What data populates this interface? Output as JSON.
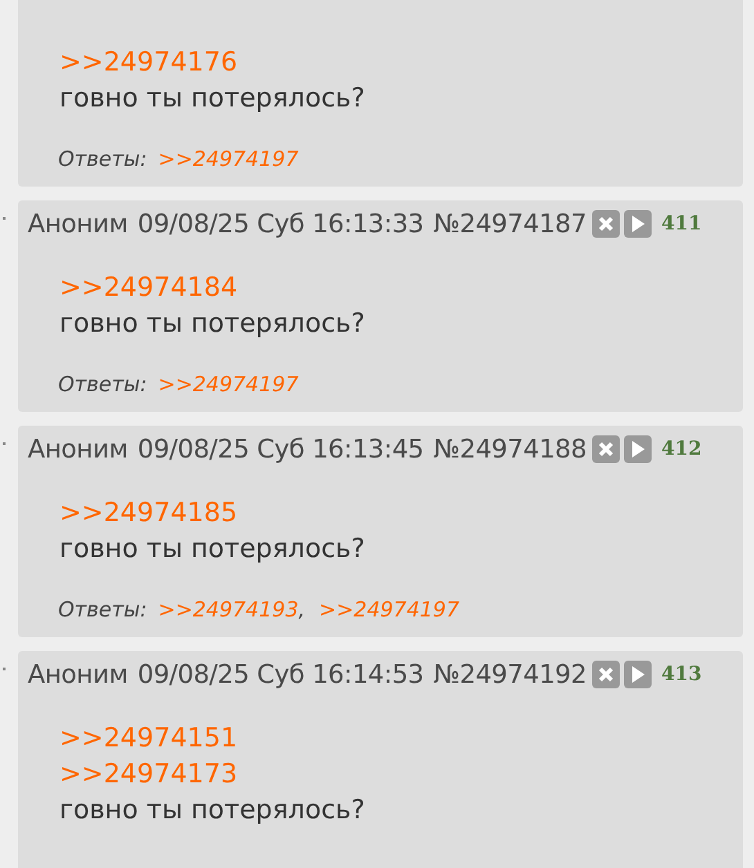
{
  "posts": [
    {
      "quotes": [
        ">>24974176"
      ],
      "text": "говно ты потерялось?",
      "replies_label": "Ответы:",
      "replies": [
        ">>24974197"
      ]
    },
    {
      "header": {
        "name": "Аноним",
        "date": "09/08/25 Суб 16:13:33",
        "number": "№24974187",
        "index": "411"
      },
      "quotes": [
        ">>24974184"
      ],
      "text": "говно ты потерялось?",
      "replies_label": "Ответы:",
      "replies": [
        ">>24974197"
      ]
    },
    {
      "header": {
        "name": "Аноним",
        "date": "09/08/25 Суб 16:13:45",
        "number": "№24974188",
        "index": "412"
      },
      "quotes": [
        ">>24974185"
      ],
      "text": "говно ты потерялось?",
      "replies_label": "Ответы:",
      "replies": [
        ">>24974193",
        ">>24974197"
      ],
      "separator": ","
    },
    {
      "header": {
        "name": "Аноним",
        "date": "09/08/25 Суб 16:14:53",
        "number": "№24974192",
        "index": "413"
      },
      "quotes": [
        ">>24974151",
        ">>24974173"
      ],
      "text": "говно ты потерялось?"
    }
  ]
}
